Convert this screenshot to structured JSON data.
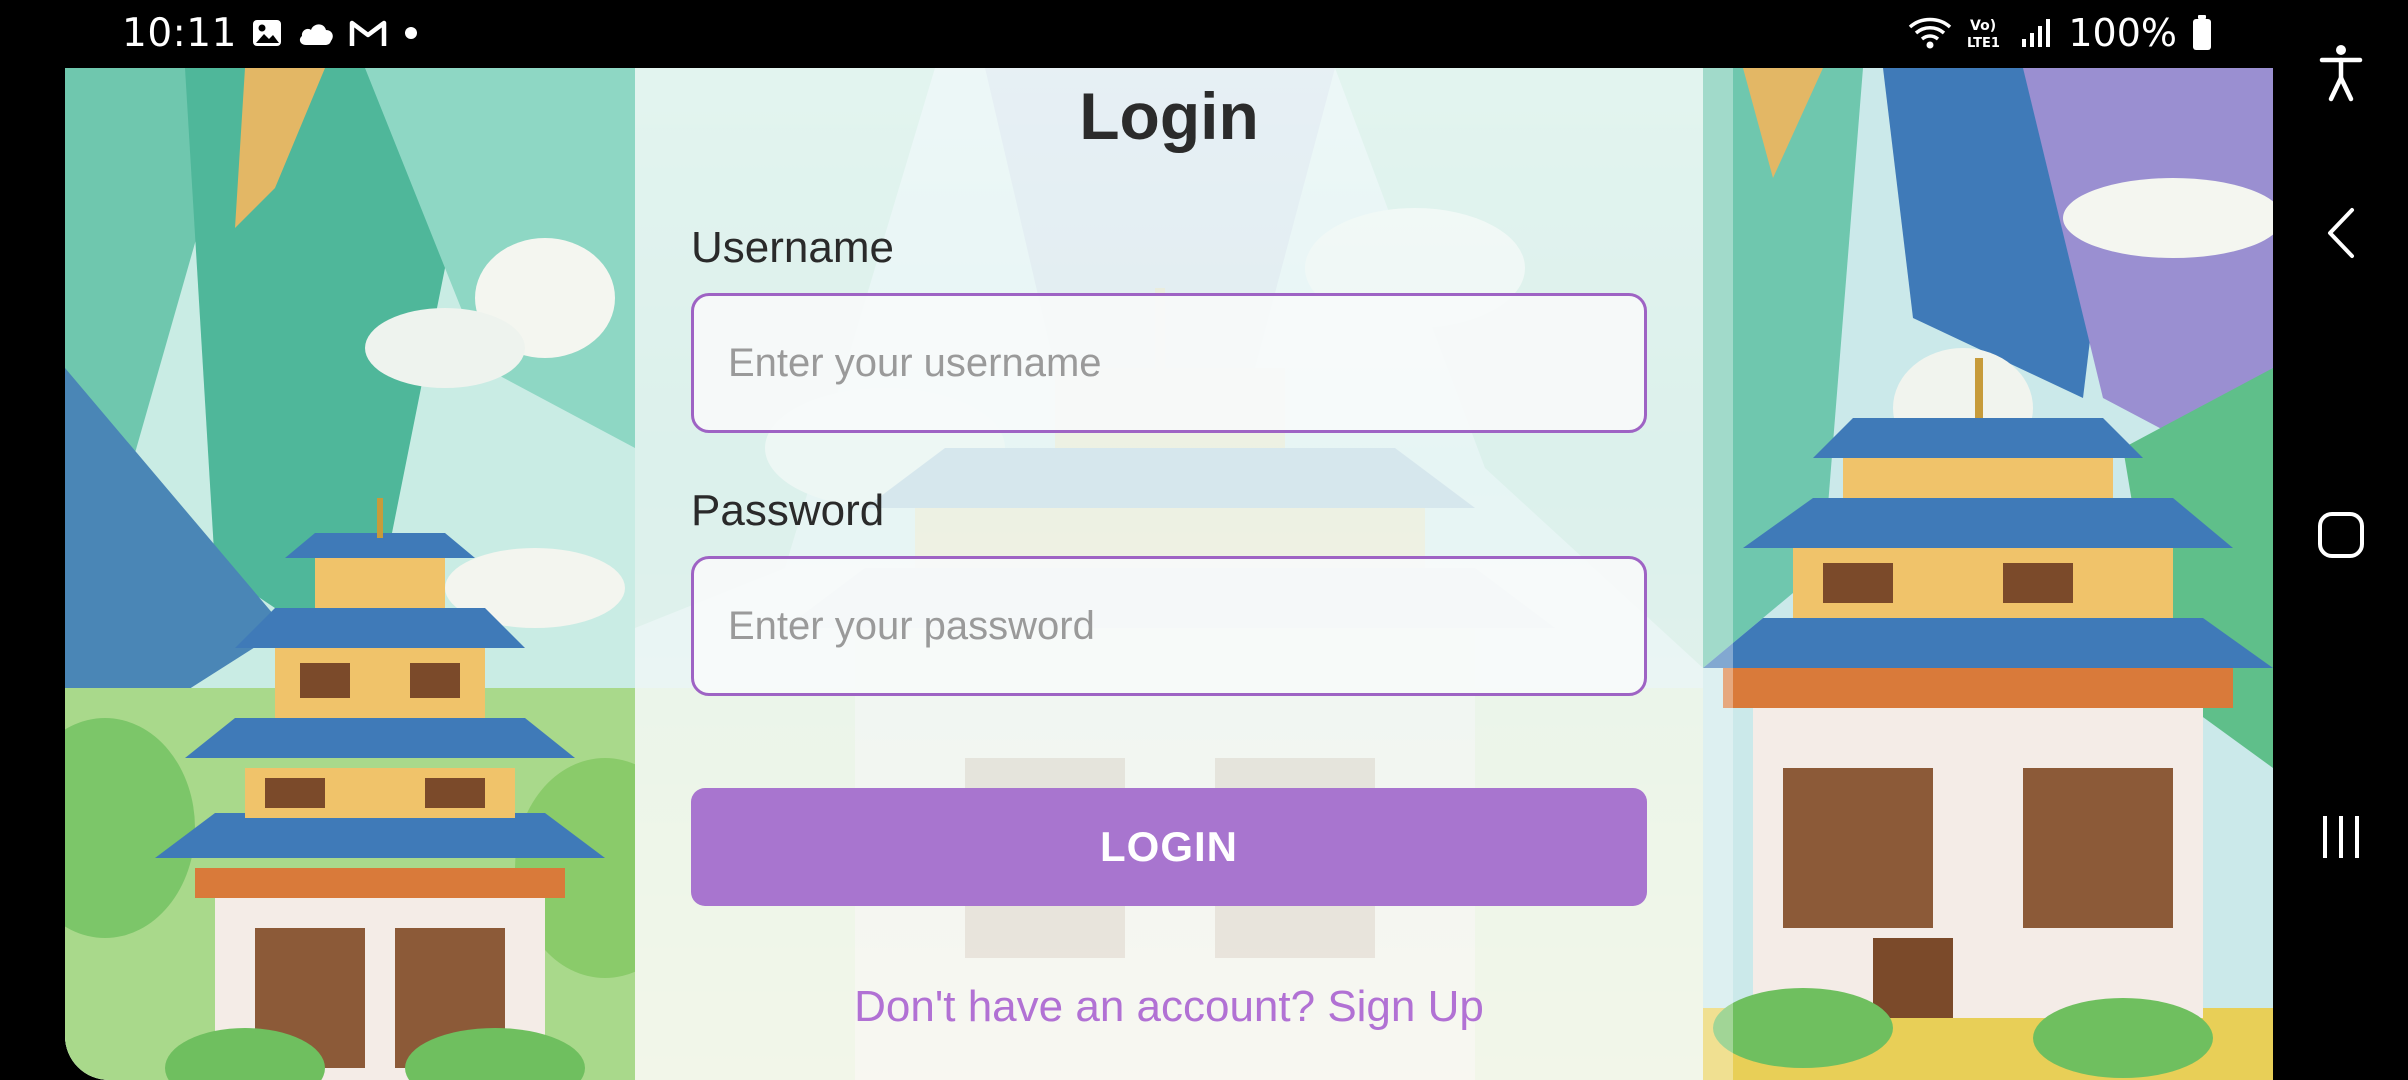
{
  "status_bar": {
    "time": "10:11",
    "battery": "100%",
    "left_icons": [
      "gallery-icon",
      "cloud-icon",
      "gmail-icon",
      "dot-icon"
    ],
    "right_icons": [
      "wifi-icon",
      "volte-icon",
      "signal-icon",
      "battery-icon"
    ]
  },
  "login": {
    "title": "Login",
    "username_label": "Username",
    "username_placeholder": "Enter your username",
    "username_value": "",
    "password_label": "Password",
    "password_placeholder": "Enter your password",
    "password_value": "",
    "login_button": "LOGIN",
    "signup_link": "Don't have an account? Sign Up"
  },
  "nav_bar": {
    "buttons": [
      "accessibility-icon",
      "back-icon",
      "home-icon",
      "recents-icon"
    ]
  },
  "colors": {
    "accent": "#a875cf",
    "input_border": "#9e63c4",
    "link": "#b171d4",
    "title": "#2b2b2b"
  }
}
